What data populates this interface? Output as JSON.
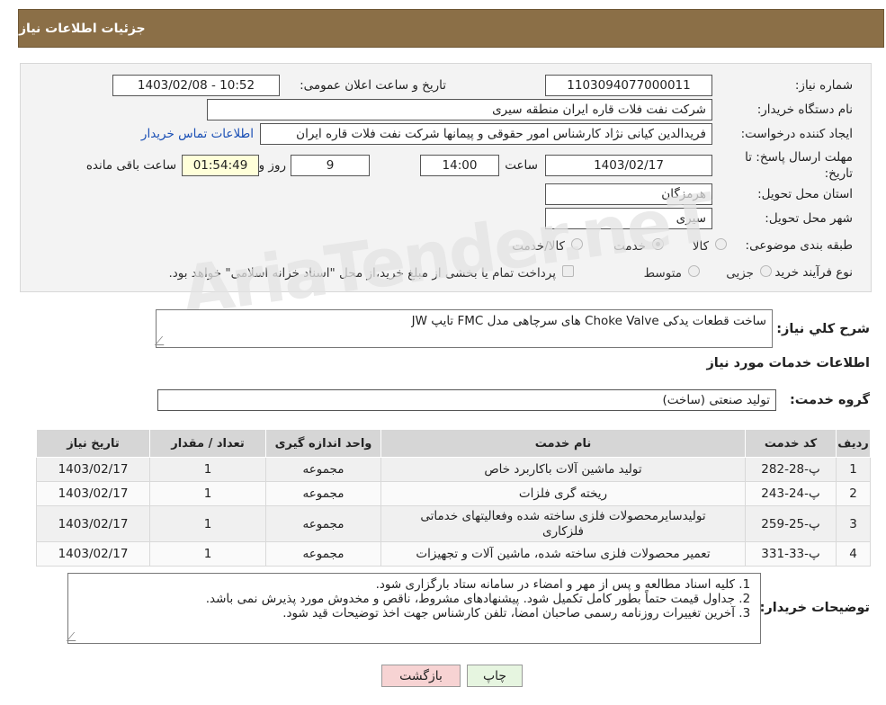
{
  "header": {
    "title": "جزئیات اطلاعات نیاز"
  },
  "form": {
    "need_number_label": "شماره نیاز:",
    "need_number": "1103094077000011",
    "announce_label": "تاریخ و ساعت اعلان عمومی:",
    "announce_value": "1403/02/08 - 10:52",
    "buyer_label": "نام دستگاه خریدار:",
    "buyer_value": "شرکت نفت فلات قاره ایران منطقه سیری",
    "creator_label": "ایجاد کننده درخواست:",
    "creator_value": "فریدالدین کیانی نژاد کارشناس امور حقوقی و پیمانها شرکت نفت فلات قاره ایران",
    "contact_link": "اطلاعات تماس خریدار",
    "deadline_label": "مهلت ارسال پاسخ: تا تاریخ:",
    "deadline_date": "1403/02/17",
    "time_label": "ساعت",
    "deadline_time": "14:00",
    "days_value": "9",
    "days_label": "روز و",
    "remaining_time": "01:54:49",
    "remaining_label": "ساعت باقی مانده",
    "province_label": "استان محل تحویل:",
    "province_value": "هرمزگان",
    "city_label": "شهر محل تحویل:",
    "city_value": "سیری",
    "category_label": "طبقه بندی موضوعی:",
    "category_options": [
      "کالا",
      "خدمت",
      "کالا/خدمت"
    ],
    "category_selected": "خدمت",
    "purchase_label": "نوع فرآیند خرید :",
    "purchase_options": [
      "جزیی",
      "متوسط"
    ],
    "payment_note": "پرداخت تمام یا بخشی از مبلغ خرید،از محل \"اسناد خزانه اسلامی\" خواهد بود."
  },
  "watermark": "AriaTender.neT",
  "summary": {
    "label": "شرح کلي نياز:",
    "value": "ساخت قطعات یدکی Choke Valve های سرچاهی مدل FMC تایپ JW"
  },
  "services": {
    "title": "اطلاعات خدمات مورد نیاز",
    "group_label": "گروه خدمت:",
    "group_value": "تولید صنعتی (ساخت)",
    "columns": [
      "ردیف",
      "کد خدمت",
      "نام خدمت",
      "واحد اندازه گیری",
      "تعداد / مقدار",
      "تاریخ نیاز"
    ],
    "rows": [
      {
        "idx": "1",
        "code": "پ-28-282",
        "name": "تولید ماشین آلات باکاربرد خاص",
        "unit": "مجموعه",
        "qty": "1",
        "date": "1403/02/17"
      },
      {
        "idx": "2",
        "code": "پ-24-243",
        "name": "ریخته گری فلزات",
        "unit": "مجموعه",
        "qty": "1",
        "date": "1403/02/17"
      },
      {
        "idx": "3",
        "code": "پ-25-259",
        "name": "تولیدسایرمحصولات فلزی ساخته شده وفعالیتهای خدماتی فلزکاری",
        "unit": "مجموعه",
        "qty": "1",
        "date": "1403/02/17"
      },
      {
        "idx": "4",
        "code": "پ-33-331",
        "name": "تعمیر محصولات فلزی ساخته شده، ماشین آلات و تجهیزات",
        "unit": "مجموعه",
        "qty": "1",
        "date": "1403/02/17"
      }
    ]
  },
  "notes": {
    "label": "توضیحات خریدار:",
    "items": [
      "کلیه اسناد مطالعه و پس از مهر و امضاء در سامانه ستاد بارگزاری شود.",
      "جداول قیمت حتماً بطور کامل تکمیل شود. پیشنهادهای مشروط، ناقص و مخدوش مورد پذیرش نمی باشد.",
      "آخرین تغییرات روزنامه رسمی صاحبان امضا، تلفن کارشناس جهت اخذ توضیحات قید شود."
    ]
  },
  "buttons": {
    "print": "چاپ",
    "back": "بازگشت"
  },
  "colors": {
    "header_bg": "#8b6f47",
    "back_btn": "#f7d3d3",
    "print_btn": "#e6f5e0"
  }
}
